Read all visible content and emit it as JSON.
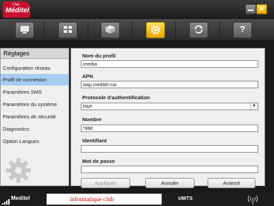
{
  "app": {
    "logo_small": "Club",
    "logo_big": "Méditel"
  },
  "window": {
    "close_glyph": "✕"
  },
  "toolbar": {
    "icons": [
      "screen-icon",
      "apps-icon",
      "box-icon",
      "gear-icon",
      "sync-icon",
      "help-icon"
    ],
    "active_icon": "gear-icon",
    "help_glyph": "?"
  },
  "sidebar": {
    "title": "Réglages",
    "items": [
      {
        "label": "Configuration réseau"
      },
      {
        "label": "Profil de connexion"
      },
      {
        "label": "Paramètres SMS"
      },
      {
        "label": "Paramètres du système"
      },
      {
        "label": "Paramètres de sécurité"
      },
      {
        "label": "Diagnostics"
      },
      {
        "label": "Option Langues"
      }
    ],
    "selected_index": 1
  },
  "form": {
    "profile_name_label": "Nom du profil",
    "profile_name_value": "imedia",
    "apn_label": "APN",
    "apn_value": "wap.meditel.ma",
    "auth_label": "Protocole d'authentification",
    "auth_value": "PAP",
    "number_label": "Nombre",
    "number_value": "*99#",
    "identifier_label": "Identifiant",
    "identifier_value": "",
    "password_label": "Mot de passe",
    "password_value": ""
  },
  "buttons": {
    "apply": "Appliquer",
    "cancel": "Annuler",
    "advanced": "Avancé"
  },
  "status_bar": {
    "carrier": "Meditel",
    "ad_text": "informatique club",
    "network_type": "UMTS"
  },
  "colors": {
    "brand_red": "#c8102e",
    "active_yellow": "#f2c200",
    "selection_blue": "#a9cdf0",
    "ad_text_red": "#c00000"
  }
}
